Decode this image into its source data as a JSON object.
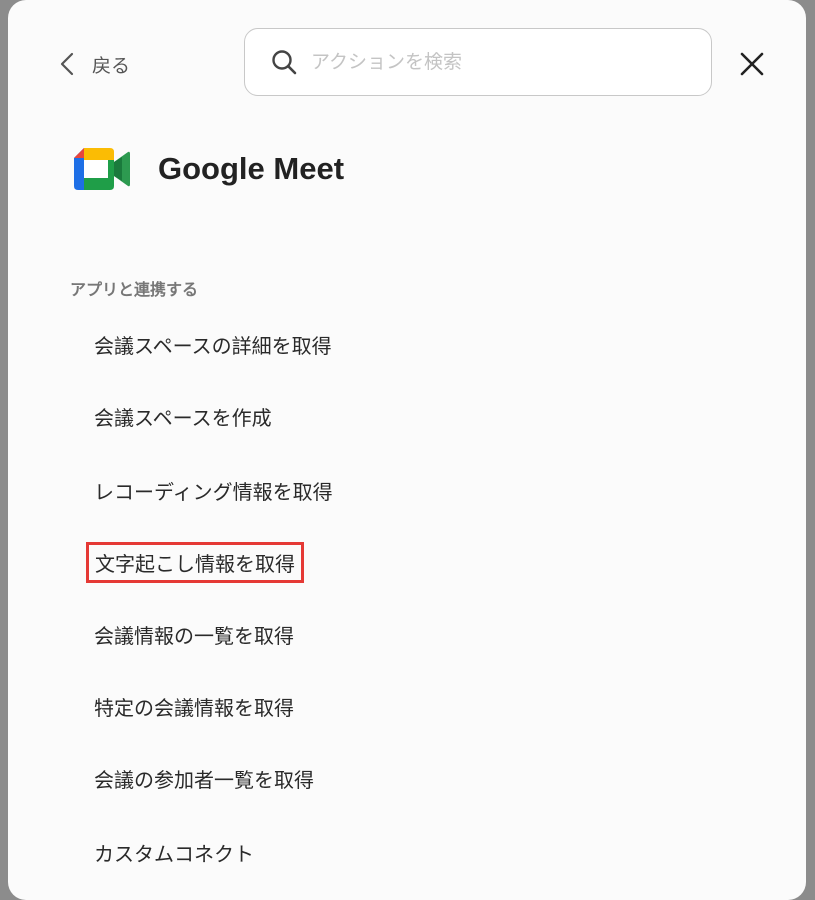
{
  "header": {
    "back_label": "戻る",
    "search_placeholder": "アクションを検索"
  },
  "app": {
    "name": "Google Meet",
    "icon": "google-meet-logo"
  },
  "section": {
    "title": "アプリと連携する"
  },
  "actions": [
    {
      "label": "会議スペースの詳細を取得",
      "highlighted": false
    },
    {
      "label": "会議スペースを作成",
      "highlighted": false
    },
    {
      "label": "レコーディング情報を取得",
      "highlighted": false
    },
    {
      "label": "文字起こし情報を取得",
      "highlighted": true
    },
    {
      "label": "会議情報の一覧を取得",
      "highlighted": false
    },
    {
      "label": "特定の会議情報を取得",
      "highlighted": false
    },
    {
      "label": "会議の参加者一覧を取得",
      "highlighted": false
    },
    {
      "label": "カスタムコネクト",
      "highlighted": false
    }
  ],
  "colors": {
    "highlight_border": "#e53935"
  }
}
